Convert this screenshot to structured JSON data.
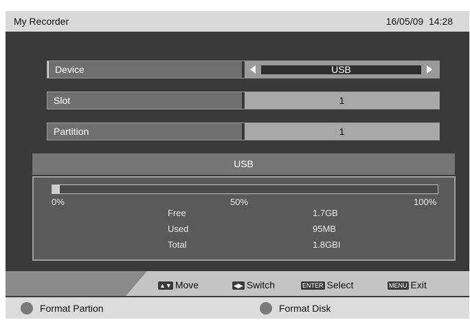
{
  "app": {
    "title": "My Recorder",
    "date": "16/05/09",
    "time": "14:28"
  },
  "settings": [
    {
      "label": "Device",
      "value": "USB"
    },
    {
      "label": "Slot",
      "value": "1"
    },
    {
      "label": "Partition",
      "value": "1"
    }
  ],
  "usb_panel": {
    "header": "USB",
    "used_fraction": 0.02,
    "pct_labels": [
      "0%",
      "50%",
      "100%"
    ],
    "stats": [
      {
        "label": "Free",
        "value": "1.7GB"
      },
      {
        "label": "Used",
        "value": "95MB"
      },
      {
        "label": "Total",
        "value": "1.8GBI"
      }
    ]
  },
  "help": {
    "move": "Move",
    "switch": "Switch",
    "select": "Select",
    "exit": "Exit",
    "enter_key": "ENTER",
    "menu_key": "MENU"
  },
  "actions": {
    "format_partition": "Format Partion",
    "format_disk": "Format Disk"
  },
  "colors": {
    "background": "#3a3a3a",
    "titlebar": "#d9d9d9",
    "panel": "#5a5a5a"
  }
}
